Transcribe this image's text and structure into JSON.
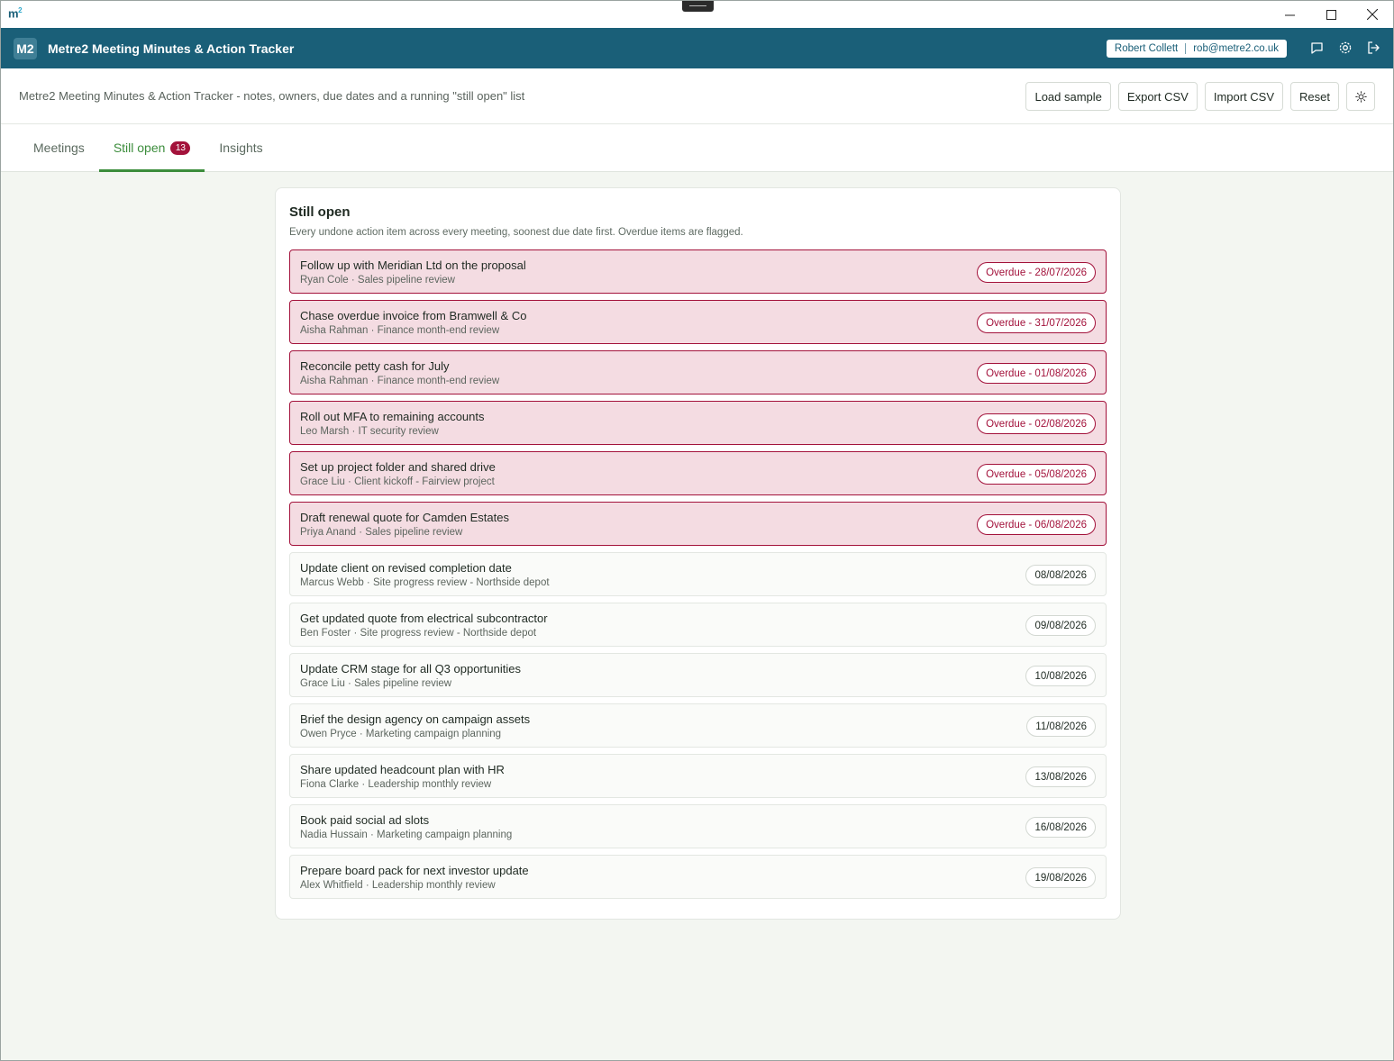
{
  "window": {
    "logo": "m",
    "logo_sup": "2"
  },
  "header": {
    "badge": "M2",
    "app_name": "Metre2 Meeting Minutes & Action Tracker",
    "user_name": "Robert Collett",
    "user_email": "rob@metre2.co.uk"
  },
  "subheader": {
    "description": "Metre2 Meeting Minutes & Action Tracker - notes, owners, due dates and a running \"still open\" list",
    "buttons": {
      "load_sample": "Load sample",
      "export_csv": "Export CSV",
      "import_csv": "Import CSV",
      "reset": "Reset"
    }
  },
  "tabs": {
    "meetings": "Meetings",
    "still_open": "Still open",
    "still_open_count": "13",
    "insights": "Insights"
  },
  "card": {
    "title": "Still open",
    "subtitle": "Every undone action item across every meeting, soonest due date first. Overdue items are flagged."
  },
  "items": [
    {
      "title": "Follow up with Meridian Ltd on the proposal",
      "meta": "Ryan Cole · Sales pipeline review",
      "due": "Overdue - 28/07/2026",
      "overdue": true
    },
    {
      "title": "Chase overdue invoice from Bramwell & Co",
      "meta": "Aisha Rahman · Finance month-end review",
      "due": "Overdue - 31/07/2026",
      "overdue": true
    },
    {
      "title": "Reconcile petty cash for July",
      "meta": "Aisha Rahman · Finance month-end review",
      "due": "Overdue - 01/08/2026",
      "overdue": true
    },
    {
      "title": "Roll out MFA to remaining accounts",
      "meta": "Leo Marsh · IT security review",
      "due": "Overdue - 02/08/2026",
      "overdue": true
    },
    {
      "title": "Set up project folder and shared drive",
      "meta": "Grace Liu · Client kickoff - Fairview project",
      "due": "Overdue - 05/08/2026",
      "overdue": true
    },
    {
      "title": "Draft renewal quote for Camden Estates",
      "meta": "Priya Anand · Sales pipeline review",
      "due": "Overdue - 06/08/2026",
      "overdue": true
    },
    {
      "title": "Update client on revised completion date",
      "meta": "Marcus Webb · Site progress review - Northside depot",
      "due": "08/08/2026",
      "overdue": false
    },
    {
      "title": "Get updated quote from electrical subcontractor",
      "meta": "Ben Foster · Site progress review - Northside depot",
      "due": "09/08/2026",
      "overdue": false
    },
    {
      "title": "Update CRM stage for all Q3 opportunities",
      "meta": "Grace Liu · Sales pipeline review",
      "due": "10/08/2026",
      "overdue": false
    },
    {
      "title": "Brief the design agency on campaign assets",
      "meta": "Owen Pryce · Marketing campaign planning",
      "due": "11/08/2026",
      "overdue": false
    },
    {
      "title": "Share updated headcount plan with HR",
      "meta": "Fiona Clarke · Leadership monthly review",
      "due": "13/08/2026",
      "overdue": false
    },
    {
      "title": "Book paid social ad slots",
      "meta": "Nadia Hussain · Marketing campaign planning",
      "due": "16/08/2026",
      "overdue": false
    },
    {
      "title": "Prepare board pack for next investor update",
      "meta": "Alex Whitfield · Leadership monthly review",
      "due": "19/08/2026",
      "overdue": false
    }
  ],
  "colors": {
    "brand": "#1a5f78",
    "accent": "#3c8d3c",
    "overdue": "#a3123b",
    "overdue_bg": "#f4dce2"
  }
}
